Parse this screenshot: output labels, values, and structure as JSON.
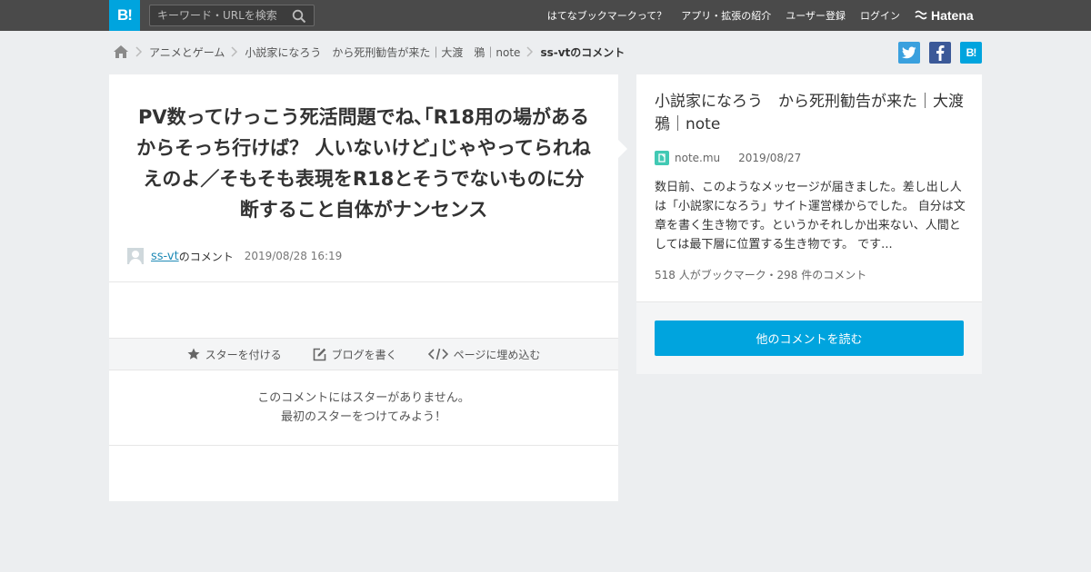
{
  "header": {
    "logo_text": "B!",
    "search_placeholder": "キーワード・URLを検索",
    "nav": [
      "はてなブックマークって？",
      "アプリ・拡張の紹介",
      "ユーザー登録",
      "ログイン"
    ],
    "brand": "Hatena"
  },
  "breadcrumb": {
    "items": [
      "アニメとゲーム",
      "小説家になろう　から死刑勧告が来た｜大渡　鴉｜note"
    ],
    "current": "ss-vtのコメント"
  },
  "share": {
    "hatena_label": "B!"
  },
  "comment": {
    "text": "PV数ってけっこう死活問題でね､｢R18用の場があるからそっち行けば？ 人いないけど｣じゃやってられねえのよ／そもそも表現をR18とそうでないものに分断すること自体がナンセンス",
    "username": "ss-vt",
    "suffix": "のコメント",
    "timestamp": "2019/08/28 16:19"
  },
  "actions": {
    "star": "スターを付ける",
    "blog": "ブログを書く",
    "embed": "ページに埋め込む"
  },
  "stars": {
    "empty_line1": "このコメントにはスターがありません。",
    "empty_line2": "最初のスターをつけてみよう！"
  },
  "entry": {
    "title": "小説家になろう　から死刑勧告が来た｜大渡　鴉｜note",
    "domain": "note.mu",
    "date": "2019/08/27",
    "summary": "数日前、このようなメッセージが届きました。差し出し人は「小説家になろう」サイト運営様からでした。 自分は文章を書く生き物です。というかそれしか出来ない、人間としては最下層に位置する生き物です。 です...",
    "stats": "518 人がブックマーク・298 件のコメント",
    "read_more": "他のコメントを読む"
  },
  "colors": {
    "accent": "#00a4de",
    "topbar": "#4a4a4a",
    "twitter": "#3aa0de",
    "facebook": "#3b5998"
  }
}
